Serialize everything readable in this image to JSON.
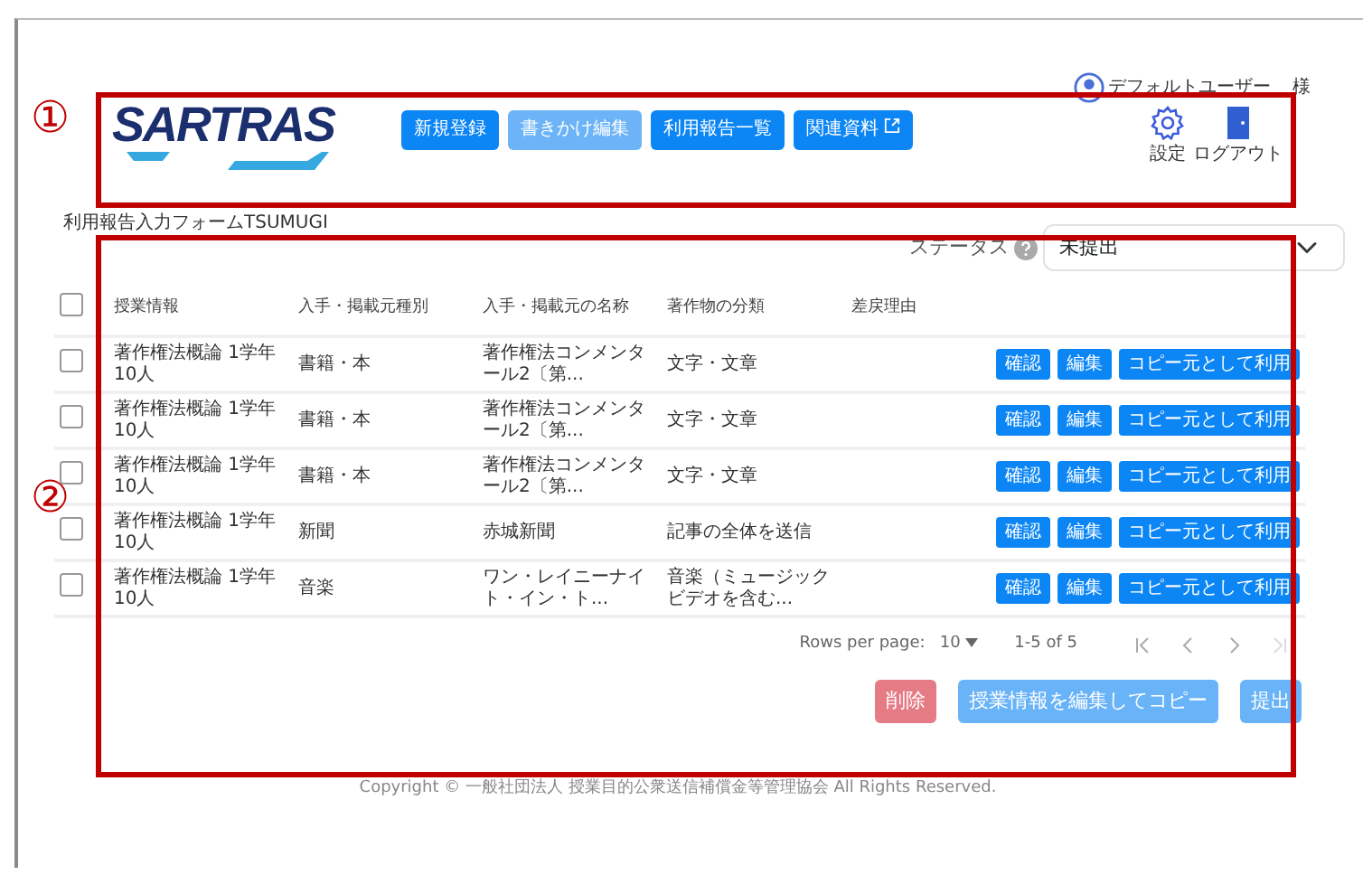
{
  "logo": "SARTRAS",
  "subtitle": "利用報告入力フォームTSUMUGI",
  "nav_buttons": [
    {
      "label": "新規登録",
      "disabled": false,
      "external": false
    },
    {
      "label": "書きかけ編集",
      "disabled": true,
      "external": false
    },
    {
      "label": "利用報告一覧",
      "disabled": false,
      "external": false
    },
    {
      "label": "関連資料",
      "disabled": false,
      "external": true
    }
  ],
  "user": {
    "name": "デフォルトユーザー",
    "suffix": "様"
  },
  "header_actions": [
    {
      "kind": "settings",
      "label": "設定"
    },
    {
      "kind": "logout",
      "label": "ログアウト"
    }
  ],
  "status_filter": {
    "label": "ステータス",
    "value": "未提出"
  },
  "table": {
    "select_all": {
      "checked": false
    },
    "columns": [
      "授業情報",
      "入手・掲載元種別",
      "入手・掲載元の名称",
      "著作物の分類",
      "差戻理由"
    ],
    "rows": [
      {
        "checked": false,
        "cells": [
          "著作権法概論 1学年 10人",
          "書籍・本",
          "著作権法コンメンタール2〔第...",
          "文字・文章",
          ""
        ],
        "actions": [
          "確認",
          "編集",
          "コピー元として利用"
        ]
      },
      {
        "checked": false,
        "cells": [
          "著作権法概論 1学年 10人",
          "書籍・本",
          "著作権法コンメンタール2〔第...",
          "文字・文章",
          ""
        ],
        "actions": [
          "確認",
          "編集",
          "コピー元として利用"
        ]
      },
      {
        "checked": false,
        "cells": [
          "著作権法概論 1学年 10人",
          "書籍・本",
          "著作権法コンメンタール2〔第...",
          "文字・文章",
          ""
        ],
        "actions": [
          "確認",
          "編集",
          "コピー元として利用"
        ]
      },
      {
        "checked": false,
        "cells": [
          "著作権法概論 1学年 10人",
          "新聞",
          "赤城新聞",
          "記事の全体を送信",
          ""
        ],
        "actions": [
          "確認",
          "編集",
          "コピー元として利用"
        ]
      },
      {
        "checked": false,
        "cells": [
          "著作権法概論 1学年 10人",
          "音楽",
          "ワン・レイニーナイト・イン・ト...",
          "音楽（ミュージックビデオを含む...",
          ""
        ],
        "actions": [
          "確認",
          "編集",
          "コピー元として利用"
        ]
      }
    ]
  },
  "pagination": {
    "rows_per_page_label": "Rows per page:",
    "rows_per_page": "10",
    "range": "1-5 of 5"
  },
  "bottom_buttons": [
    {
      "kind": "danger",
      "label": "削除",
      "disabled": true
    },
    {
      "kind": "primary",
      "label": "授業情報を編集してコピー",
      "disabled": true
    },
    {
      "kind": "primary",
      "label": "提出",
      "disabled": true
    }
  ],
  "footer": "Copyright © 一般社団法人 授業目的公衆送信補償金等管理協会 All Rights Reserved.",
  "annotations": [
    {
      "label": "①"
    },
    {
      "label": "②"
    }
  ]
}
